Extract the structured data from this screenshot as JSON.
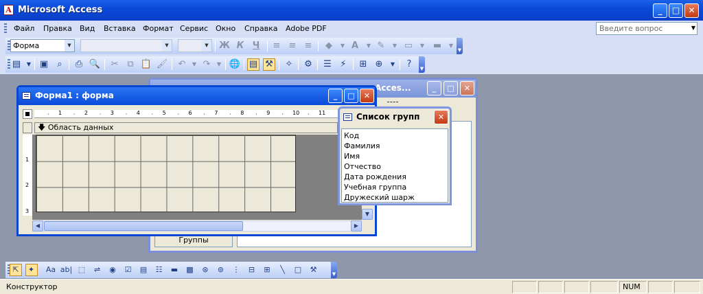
{
  "app": {
    "title": "Microsoft Access",
    "icon_letter": "A"
  },
  "menu": {
    "items": [
      "Файл",
      "Правка",
      "Вид",
      "Вставка",
      "Формат",
      "Сервис",
      "Окно",
      "Справка",
      "Adobe PDF"
    ],
    "ask_placeholder": "Введите вопрос"
  },
  "format_toolbar": {
    "object_combo": "Форма",
    "font_combo": "",
    "size_combo": "",
    "bold": "Ж",
    "italic": "К",
    "underline": "Ч"
  },
  "form_window": {
    "title": "Форма1 : форма",
    "section_header": "Область данных",
    "ruler_marks": [
      "1",
      "2",
      "3",
      "4",
      "5",
      "6",
      "7",
      "8",
      "9",
      "10",
      "11"
    ],
    "vruler_marks": [
      "1",
      "2",
      "3"
    ]
  },
  "background_window": {
    "title_fragment": "т Acces...",
    "button_label": "Группы"
  },
  "field_list": {
    "title": "Список групп",
    "fields": [
      "Код",
      "Фамилия",
      "Имя",
      "Отчество",
      "Дата рождения",
      "Учебная группа",
      "Дружеский шарж"
    ]
  },
  "statusbar": {
    "left": "Конструктор",
    "num": "NUM"
  },
  "icons": {
    "toolbox": [
      "pointer-icon",
      "wizard-icon",
      "label-icon",
      "textbox-icon",
      "option-group-icon",
      "toggle-icon",
      "option-icon",
      "checkbox-icon",
      "combo-icon",
      "listbox-icon",
      "button-icon",
      "image-icon",
      "unbound-object-icon",
      "bound-object-icon",
      "page-break-icon",
      "tab-icon",
      "subform-icon",
      "line-icon",
      "rectangle-icon",
      "more-controls-icon"
    ]
  }
}
